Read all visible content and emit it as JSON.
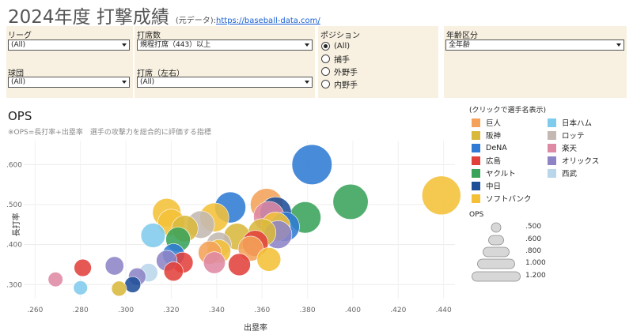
{
  "header": {
    "title": "2024年度 打撃成績",
    "source_label": "(元データ):",
    "source_url": "https://baseball-data.com/"
  },
  "filters": {
    "league": {
      "label": "リーグ",
      "value": "(All)"
    },
    "team": {
      "label": "球団",
      "value": "(All)"
    },
    "plate_appearances": {
      "label": "打席数",
      "value": "規程打席（443）以上"
    },
    "batting_side": {
      "label": "打席（左右）",
      "value": "(All)"
    },
    "position": {
      "label": "ポジション",
      "options": [
        "(All)",
        "捕手",
        "外野手",
        "内野手"
      ],
      "selected": "(All)"
    },
    "age_group": {
      "label": "年齢区分",
      "value": "全年齢"
    }
  },
  "legend": {
    "title": "(クリックで選手名表示)",
    "teams": [
      {
        "name": "巨人",
        "color": "#f4a259"
      },
      {
        "name": "阪神",
        "color": "#d9b83c"
      },
      {
        "name": "DeNA",
        "color": "#2f7bd4"
      },
      {
        "name": "広島",
        "color": "#e2413b"
      },
      {
        "name": "ヤクルト",
        "color": "#3aa35a"
      },
      {
        "name": "中日",
        "color": "#1f4e99"
      },
      {
        "name": "ソフトバンク",
        "color": "#f4c038"
      },
      {
        "name": "日本ハム",
        "color": "#7fcbec"
      },
      {
        "name": "ロッテ",
        "color": "#c3b8b2"
      },
      {
        "name": "楽天",
        "color": "#df8aa5"
      },
      {
        "name": "オリックス",
        "color": "#8d84c6"
      },
      {
        "name": "西武",
        "color": "#bad6ea"
      }
    ]
  },
  "size_legend": {
    "title": "OPS",
    "values": [
      0.5,
      0.6,
      0.8,
      1.0,
      1.2
    ],
    "labels": [
      ".500",
      ".600",
      ".800",
      "1.000",
      "1.200"
    ]
  },
  "chart_data": {
    "type": "scatter",
    "title": "OPS",
    "subtitle": "※OPS=長打率+出塁率　選手の攻撃力を総合的に評価する指標",
    "xlabel": "出塁率",
    "ylabel": "長打率",
    "xlim": [
      0.255,
      0.445
    ],
    "ylim": [
      0.265,
      0.66
    ],
    "xticks": [
      0.26,
      0.28,
      0.3,
      0.32,
      0.34,
      0.36,
      0.38,
      0.4,
      0.42,
      0.44
    ],
    "xtick_labels": [
      ".260",
      ".280",
      ".300",
      ".320",
      ".340",
      ".360",
      ".380",
      ".400",
      ".420",
      ".440"
    ],
    "yticks": [
      0.3,
      0.4,
      0.5,
      0.6
    ],
    "ytick_labels": [
      ".300",
      ".400",
      ".500",
      ".600"
    ],
    "grid": true,
    "size_encodes": "OPS",
    "points": [
      {
        "team": "DeNA",
        "x": 0.382,
        "y": 0.6
      },
      {
        "team": "ヤクルト",
        "x": 0.399,
        "y": 0.507
      },
      {
        "team": "ソフトバンク",
        "x": 0.439,
        "y": 0.523
      },
      {
        "team": "ヤクルト",
        "x": 0.379,
        "y": 0.468
      },
      {
        "team": "DeNA",
        "x": 0.37,
        "y": 0.445
      },
      {
        "team": "中日",
        "x": 0.366,
        "y": 0.48
      },
      {
        "team": "巨人",
        "x": 0.362,
        "y": 0.5
      },
      {
        "team": "楽天",
        "x": 0.363,
        "y": 0.47
      },
      {
        "team": "ソフトバンク",
        "x": 0.366,
        "y": 0.445
      },
      {
        "team": "DeNA",
        "x": 0.346,
        "y": 0.493
      },
      {
        "team": "阪神",
        "x": 0.36,
        "y": 0.43
      },
      {
        "team": "オリックス",
        "x": 0.367,
        "y": 0.425
      },
      {
        "team": "ソフトバンク",
        "x": 0.339,
        "y": 0.468
      },
      {
        "team": "広島",
        "x": 0.357,
        "y": 0.403
      },
      {
        "team": "巨人",
        "x": 0.355,
        "y": 0.39
      },
      {
        "team": "ソフトバンク",
        "x": 0.363,
        "y": 0.363
      },
      {
        "team": "阪神",
        "x": 0.349,
        "y": 0.42
      },
      {
        "team": "広島",
        "x": 0.35,
        "y": 0.35
      },
      {
        "team": "楽天",
        "x": 0.339,
        "y": 0.355
      },
      {
        "team": "ロッテ",
        "x": 0.333,
        "y": 0.45
      },
      {
        "team": "阪神",
        "x": 0.326,
        "y": 0.44
      },
      {
        "team": "ヤクルト",
        "x": 0.323,
        "y": 0.413
      },
      {
        "team": "ロッテ",
        "x": 0.341,
        "y": 0.4
      },
      {
        "team": "巨人",
        "x": 0.337,
        "y": 0.38
      },
      {
        "team": "ソフトバンク",
        "x": 0.341,
        "y": 0.383
      },
      {
        "team": "DeNA",
        "x": 0.321,
        "y": 0.375
      },
      {
        "team": "広島",
        "x": 0.325,
        "y": 0.355
      },
      {
        "team": "ソフトバンク",
        "x": 0.318,
        "y": 0.48
      },
      {
        "team": "ソフトバンク",
        "x": 0.32,
        "y": 0.455
      },
      {
        "team": "日本ハム",
        "x": 0.312,
        "y": 0.423
      },
      {
        "team": "オリックス",
        "x": 0.318,
        "y": 0.36
      },
      {
        "team": "広島",
        "x": 0.321,
        "y": 0.333
      },
      {
        "team": "西武",
        "x": 0.31,
        "y": 0.33
      },
      {
        "team": "オリックス",
        "x": 0.305,
        "y": 0.32
      },
      {
        "team": "中日",
        "x": 0.303,
        "y": 0.3
      },
      {
        "team": "オリックス",
        "x": 0.295,
        "y": 0.347
      },
      {
        "team": "阪神",
        "x": 0.297,
        "y": 0.29
      },
      {
        "team": "広島",
        "x": 0.281,
        "y": 0.342
      },
      {
        "team": "楽天",
        "x": 0.269,
        "y": 0.313
      },
      {
        "team": "日本ハム",
        "x": 0.28,
        "y": 0.292
      }
    ]
  }
}
